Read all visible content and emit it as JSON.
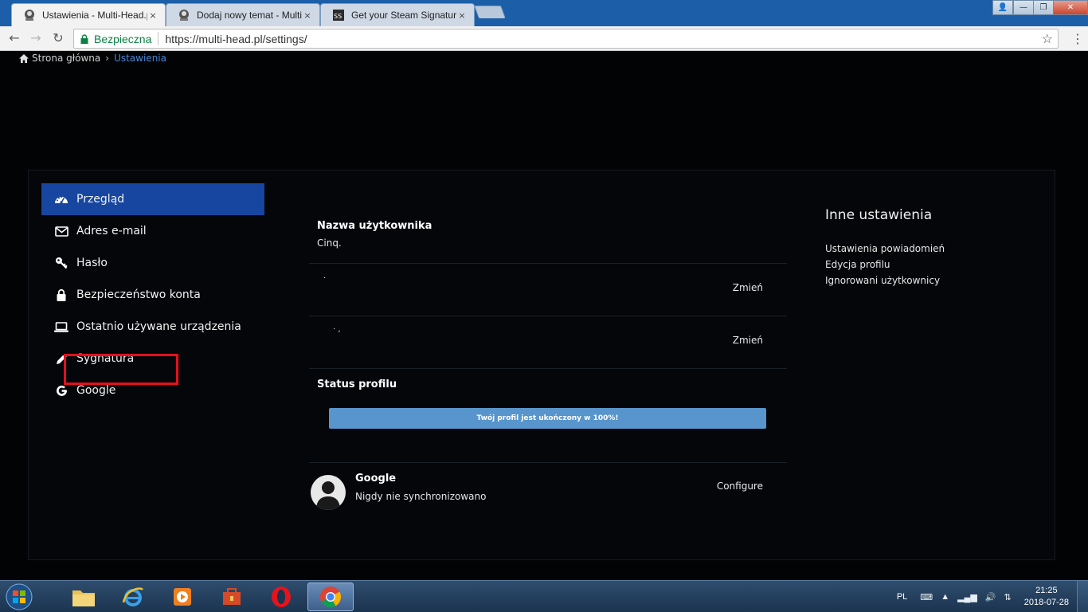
{
  "browser": {
    "tabs": [
      {
        "title": "Ustawienia - Multi-Head.pl",
        "active": true
      },
      {
        "title": "Dodaj nowy temat - Multi",
        "active": false
      },
      {
        "title": "Get your Steam Signature",
        "active": false
      }
    ],
    "close_glyph": "×",
    "window_controls": {
      "user": "👤",
      "minimize": "—",
      "maximize": "❐",
      "close": "✕"
    },
    "nav": {
      "back": "←",
      "forward": "→",
      "reload": "↻"
    },
    "address": {
      "secure_label": "Bezpieczna",
      "url": "https://multi-head.pl/settings/",
      "star": "☆",
      "menu": "⋮"
    }
  },
  "breadcrumb": {
    "home": "Strona główna",
    "separator": "›",
    "current": "Ustawienia"
  },
  "sidebar": {
    "items": [
      {
        "label": "Przegląd",
        "icon": "dashboard-icon",
        "active": true
      },
      {
        "label": "Adres e-mail",
        "icon": "envelope-icon",
        "active": false
      },
      {
        "label": "Hasło",
        "icon": "key-icon",
        "active": false
      },
      {
        "label": "Bezpieczeństwo konta",
        "icon": "lock-icon",
        "active": false
      },
      {
        "label": "Ostatnio używane urządzenia",
        "icon": "laptop-icon",
        "active": false
      },
      {
        "label": "Sygnatura",
        "icon": "pencil-icon",
        "active": false
      },
      {
        "label": "Google",
        "icon": "google-icon",
        "active": false
      }
    ]
  },
  "main": {
    "username_title": "Nazwa użytkownika",
    "username_value": "Cinq.",
    "row2": {
      "placeholder_mark": "·",
      "action": "Zmień"
    },
    "row3": {
      "placeholder_mark": "· ,",
      "action": "Zmień"
    },
    "status_title": "Status profilu",
    "progress": {
      "text": "Twój profil jest ukończony w 100%!",
      "percent": 100
    },
    "google": {
      "title": "Google",
      "subtitle": "Nigdy nie synchronizowano",
      "action": "Configure"
    }
  },
  "other": {
    "title": "Inne ustawienia",
    "links": [
      "Ustawienia powiadomień",
      "Edycja profilu",
      "Ignorowani użytkownicy"
    ]
  },
  "taskbar": {
    "lang": "PL",
    "time": "21:25",
    "date": "2018-07-28",
    "tray_icons": {
      "keyboard": "⌨",
      "chevron": "▲",
      "signal": "▂▄▆",
      "volume": "🔊",
      "network": "⇅"
    }
  },
  "colors": {
    "accent": "#1746a0",
    "progress": "#5795cc",
    "highlight": "#e3101f",
    "link": "#4a86d8",
    "secure": "#0b8043"
  }
}
